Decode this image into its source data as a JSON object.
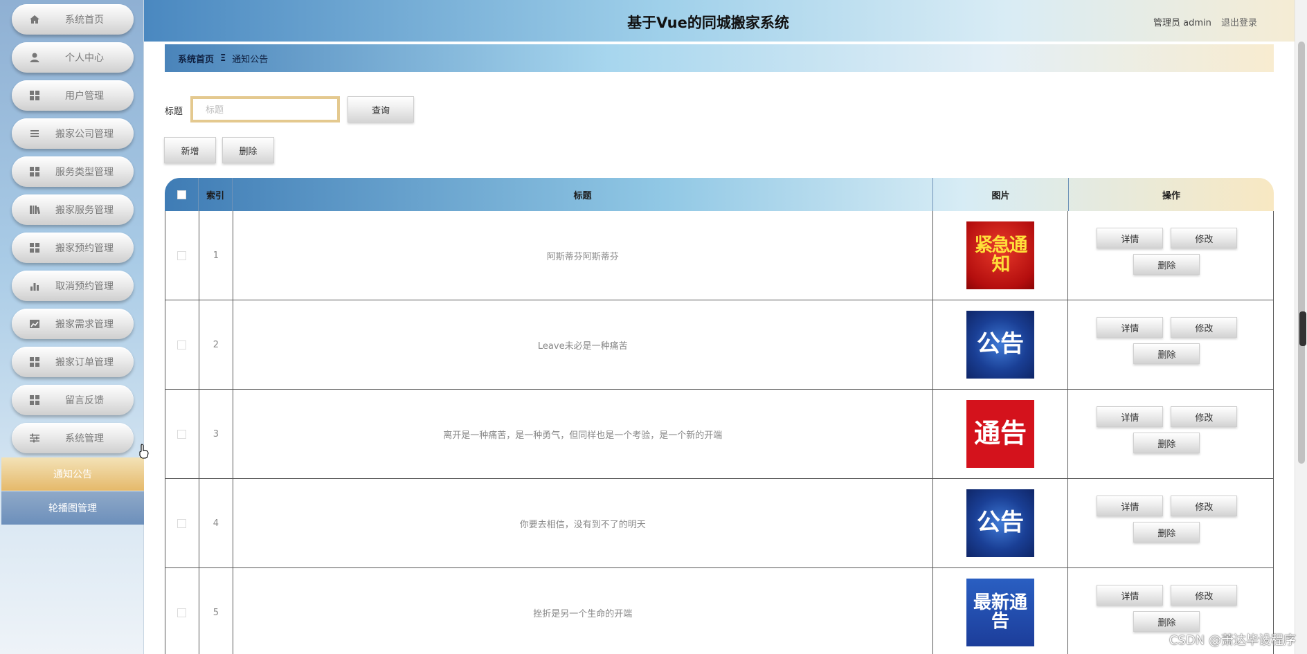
{
  "app": {
    "title": "基于Vue的同城搬家系统"
  },
  "header": {
    "user_label": "管理员 admin",
    "logout_label": "退出登录"
  },
  "sidebar": {
    "items": [
      {
        "label": "系统首页",
        "icon": "home-icon"
      },
      {
        "label": "个人中心",
        "icon": "user-icon"
      },
      {
        "label": "用户管理",
        "icon": "grid-icon"
      },
      {
        "label": "搬家公司管理",
        "icon": "list-icon"
      },
      {
        "label": "服务类型管理",
        "icon": "grid-icon"
      },
      {
        "label": "搬家服务管理",
        "icon": "bars-icon"
      },
      {
        "label": "搬家预约管理",
        "icon": "grid-icon"
      },
      {
        "label": "取消预约管理",
        "icon": "chart-icon"
      },
      {
        "label": "搬家需求管理",
        "icon": "image-chart-icon"
      },
      {
        "label": "搬家订单管理",
        "icon": "grid-icon"
      },
      {
        "label": "留言反馈",
        "icon": "grid-icon"
      },
      {
        "label": "系统管理",
        "icon": "sliders-icon"
      }
    ],
    "sub_items": [
      {
        "label": "通知公告",
        "active": true
      },
      {
        "label": "轮播图管理",
        "active": false
      }
    ]
  },
  "breadcrumb": {
    "home": "系统首页",
    "separator": "Ξ",
    "current": "通知公告"
  },
  "search": {
    "label": "标题",
    "placeholder": "标题",
    "value": "",
    "query_label": "查询"
  },
  "actions": {
    "add_label": "新增",
    "delete_label": "删除"
  },
  "table": {
    "columns": [
      "索引",
      "标题",
      "图片",
      "操作"
    ],
    "rows": [
      {
        "index": "1",
        "title": "阿斯蒂芬阿斯蒂芬",
        "image_text": "紧急通知",
        "image_style": "red"
      },
      {
        "index": "2",
        "title": "Leave未必是一种痛苦",
        "image_text": "公告",
        "image_style": "blue"
      },
      {
        "index": "3",
        "title": "离开是一种痛苦，是一种勇气，但同样也是一个考验，是一个新的开端",
        "image_text": "通告",
        "image_style": "red2"
      },
      {
        "index": "4",
        "title": "你要去相信，没有到不了的明天",
        "image_text": "公告",
        "image_style": "blue"
      },
      {
        "index": "5",
        "title": "挫折是另一个生命的开端",
        "image_text": "最新通告",
        "image_style": "blue2"
      }
    ],
    "row_actions": {
      "detail": "详情",
      "edit": "修改",
      "delete": "删除"
    }
  },
  "watermark": "CSDN @萧达毕设程序",
  "colors": {
    "accent_gold": "#e5b96a",
    "header_blue": "#4a88c0",
    "active_sub": "#e5b96a"
  }
}
